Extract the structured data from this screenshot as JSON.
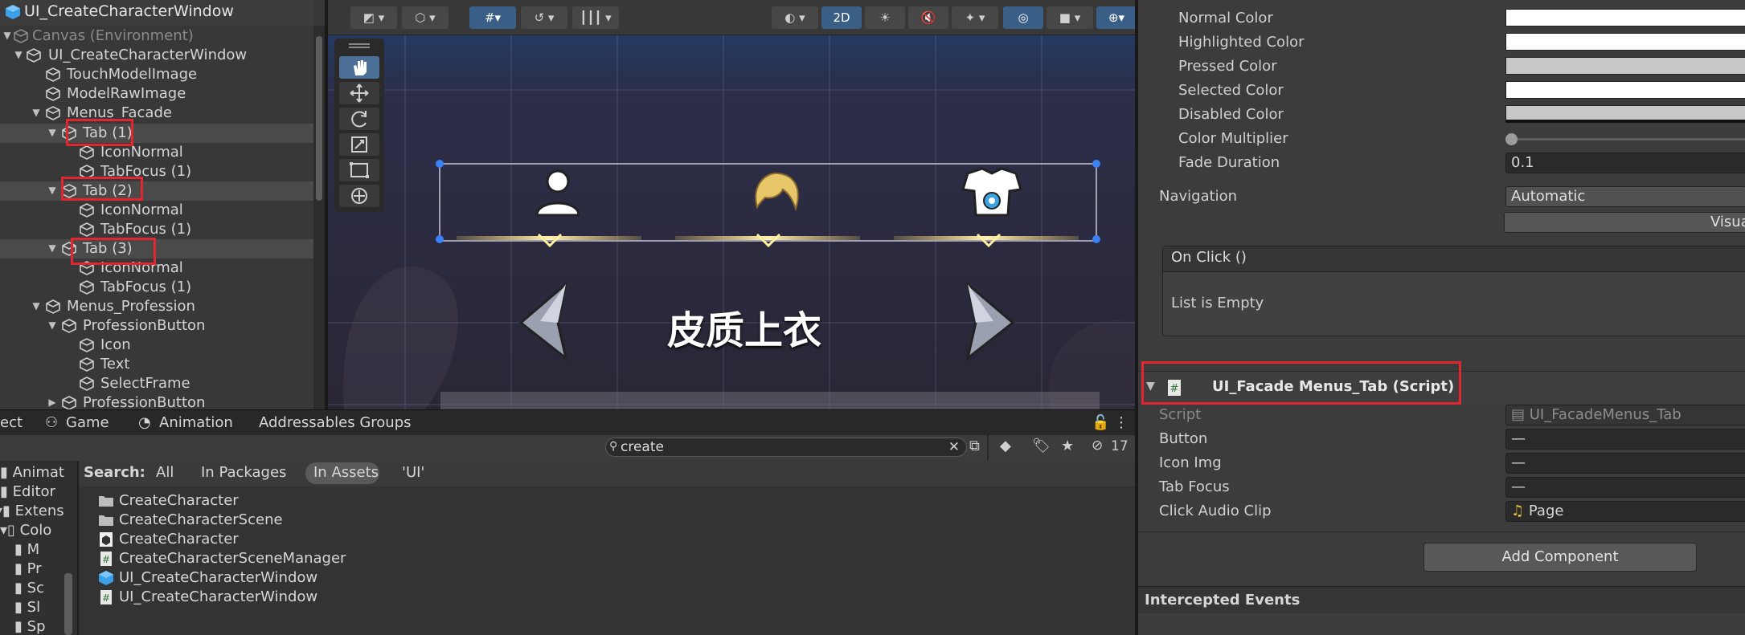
{
  "hierarchy": {
    "title": "UI_CreateCharacterWindow",
    "rows": [
      {
        "label": "Canvas (Environment)"
      },
      {
        "label": "UI_CreateCharacterWindow"
      },
      {
        "label": "TouchModelImage"
      },
      {
        "label": "ModelRawImage"
      },
      {
        "label": "Menus_Facade"
      },
      {
        "label": "Tab (1)"
      },
      {
        "label": "IconNormal"
      },
      {
        "label": "TabFocus (1)"
      },
      {
        "label": "Tab (2)"
      },
      {
        "label": "IconNormal"
      },
      {
        "label": "TabFocus (1)"
      },
      {
        "label": "Tab (3)"
      },
      {
        "label": "IconNormal"
      },
      {
        "label": "TabFocus (1)"
      },
      {
        "label": "Menus_Profession"
      },
      {
        "label": "ProfessionButton"
      },
      {
        "label": "Icon"
      },
      {
        "label": "Text"
      },
      {
        "label": "SelectFrame"
      },
      {
        "label": "ProfessionButton"
      }
    ]
  },
  "scene": {
    "toolbar_2d": "2D",
    "center_text": "皮质上衣"
  },
  "bottom_tabs": {
    "project": "ect",
    "game": "Game",
    "animation": "Animation",
    "addressables": "Addressables Groups"
  },
  "project": {
    "search_value": "create",
    "hidden_count": "17",
    "search_label": "Search:",
    "scopes": [
      "All",
      "In Packages",
      "In Assets",
      "'UI'"
    ],
    "tree": [
      "Animat",
      "Editor",
      "Extens",
      "Colo",
      "M",
      "Pr",
      "Sc",
      "Sl",
      "Sp"
    ],
    "results": [
      {
        "name": "CreateCharacter",
        "icon": "folder-icon"
      },
      {
        "name": "CreateCharacterScene",
        "icon": "folder-icon"
      },
      {
        "name": "CreateCharacter",
        "icon": "scene-icon"
      },
      {
        "name": "CreateCharacterSceneManager",
        "icon": "script-icon"
      },
      {
        "name": "UI_CreateCharacterWindow",
        "icon": "prefab-icon"
      },
      {
        "name": "UI_CreateCharacterWindow",
        "icon": "script-icon"
      }
    ]
  },
  "inspector": {
    "colors": [
      {
        "label": "Normal Color"
      },
      {
        "label": "Highlighted Color"
      },
      {
        "label": "Pressed Color"
      },
      {
        "label": "Selected Color"
      },
      {
        "label": "Disabled Color"
      }
    ],
    "color_multiplier_label": "Color Multiplier",
    "fade_duration_label": "Fade Duration",
    "fade_duration_value": "0.1",
    "navigation_label": "Navigation",
    "navigation_value": "Automatic",
    "visualize_label": "Visua",
    "onclick_title": "On Click ()",
    "onclick_empty": "List is Empty",
    "component_title": "UI_Facade Menus_Tab (Script)",
    "script_label": "Script",
    "script_value": "UI_FacadeMenus_Tab",
    "button_label": "Button",
    "button_value": "—",
    "icon_img_label": "Icon Img",
    "icon_img_value": "—",
    "tab_focus_label": "Tab Focus",
    "tab_focus_value": "—",
    "click_audio_label": "Click Audio Clip",
    "click_audio_value": "Page",
    "add_component": "Add Component",
    "intercepted_events": "Intercepted Events"
  }
}
